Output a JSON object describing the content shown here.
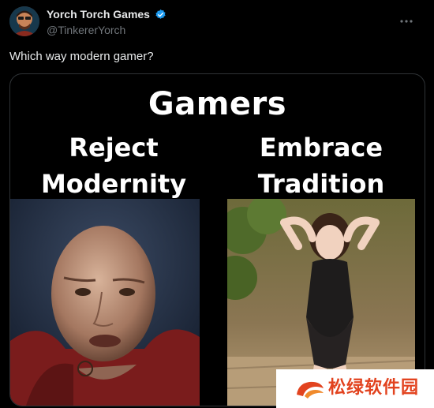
{
  "author": {
    "display_name": "Yorch Torch Games",
    "handle": "@TinkererYorch",
    "verified": true
  },
  "tweet": {
    "text": "Which way modern gamer?"
  },
  "meme": {
    "title": "Gamers",
    "left_caption": "Reject\nModernity",
    "right_caption": "Embrace\nTradition"
  },
  "watermark": {
    "text": "松绿软件园"
  },
  "colors": {
    "background": "#000000",
    "text_primary": "#e7e9ea",
    "text_secondary": "#71767b",
    "verified_blue": "#1d9bf0",
    "watermark_orange": "#e2431f"
  },
  "icons": {
    "verified": "verified-badge-icon",
    "more": "more-options-icon"
  }
}
